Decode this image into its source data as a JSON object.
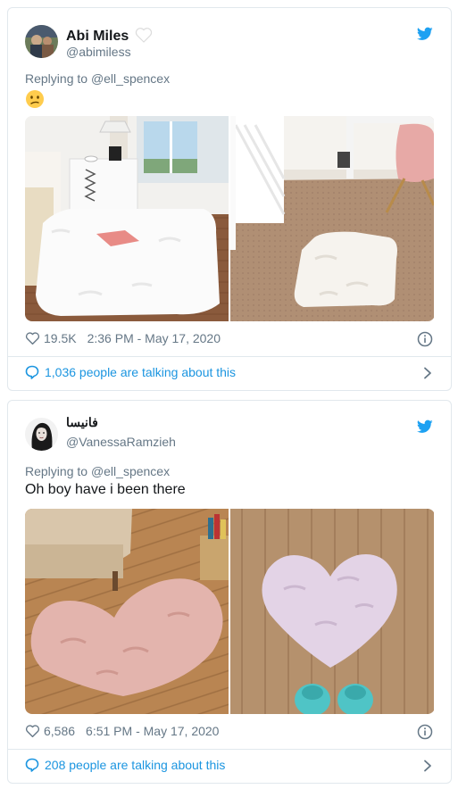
{
  "tweets": [
    {
      "name": "Abi Miles",
      "handle": "@abimiless",
      "reply_prefix": "Replying to",
      "reply_to": "@ell_spencex",
      "emoji": "confused-face-emoji",
      "likes": "19.5K",
      "timestamp": "2:36 PM - May 17, 2020",
      "talking": "1,036 people are talking about this",
      "images": [
        "white-fluffy-rug-bedroom",
        "small-white-fluffy-rug-carpet"
      ]
    },
    {
      "name": "فانيسا",
      "handle": "@VanessaRamzieh",
      "reply_prefix": "Replying to",
      "reply_to": "@ell_spencex",
      "text": "Oh boy have i been there",
      "likes": "6,586",
      "timestamp": "6:51 PM - May 17, 2020",
      "talking": "208 people are talking about this",
      "images": [
        "pink-heart-rug-wood-floor",
        "lavender-heart-rug-slippers"
      ]
    }
  ],
  "colors": {
    "link": "#1b95e0",
    "twitter_blue": "#1da1f2",
    "secondary_text": "#657786",
    "border": "#e1e8ed"
  },
  "icons": [
    "twitter-bird-icon",
    "heart-outline-icon",
    "info-icon",
    "speech-bubble-icon",
    "chevron-right-icon",
    "white-heart-badge-icon"
  ]
}
